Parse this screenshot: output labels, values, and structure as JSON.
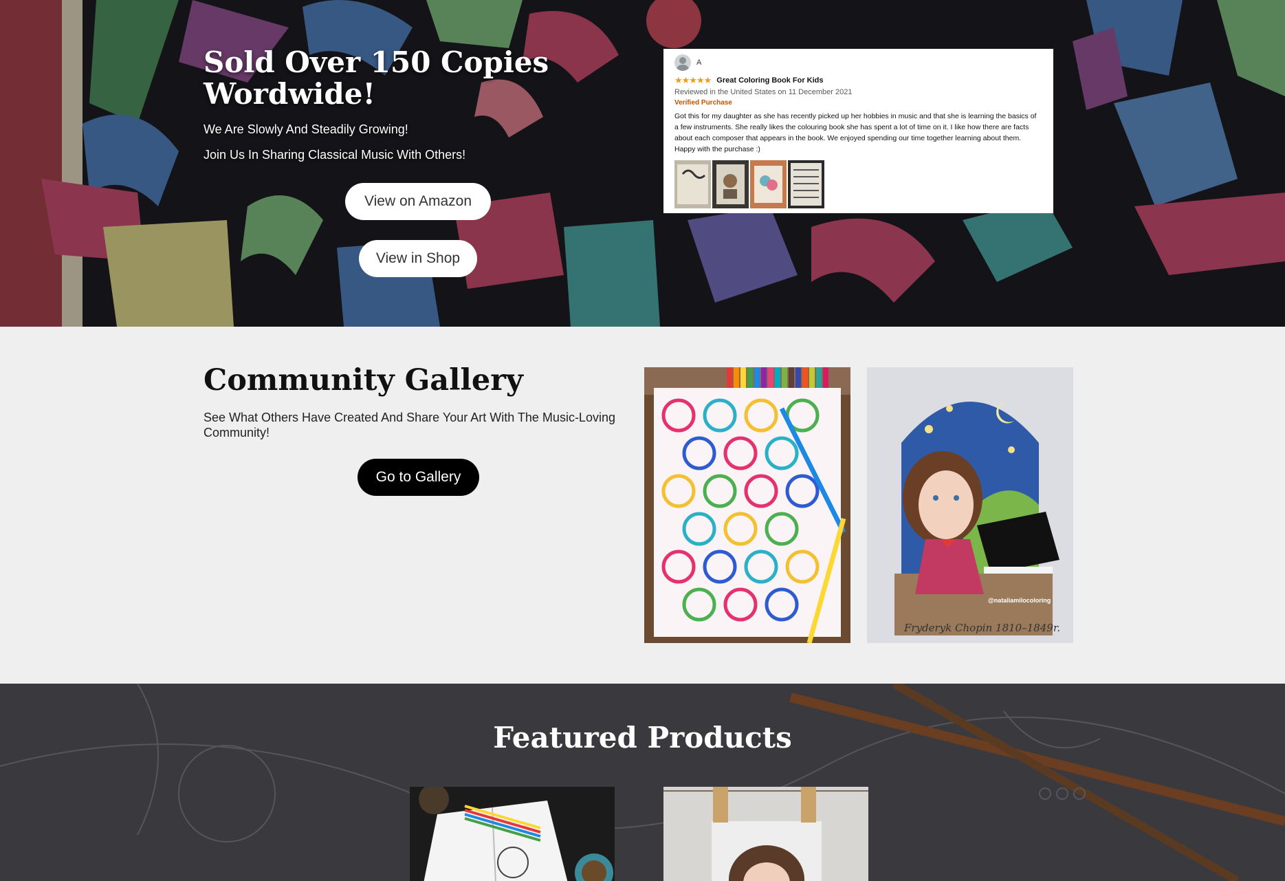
{
  "hero": {
    "title": "Sold Over 150 Copies Wordwide!",
    "line1": "We Are Slowly And Steadily Growing!",
    "line2": "Join Us In Sharing Classical Music With Others!",
    "amazon_button": "View on Amazon",
    "shop_button": "View in Shop"
  },
  "review": {
    "reviewer": "A",
    "stars": "★★★★★",
    "rating": 5,
    "title": "Great Coloring Book For Kids",
    "meta": "Reviewed in the United States on 11 December 2021",
    "verified": "Verified Purchase",
    "body": "Got this for my daughter as she has recently picked up her hobbies in music and that she is learning the basics of a few instruments. She really likes the colouring book she has spent a lot of time on it. I like how there are facts about each composer that appears in the book. We enjoyed spending our time together learning about them. Happy with the purchase :)"
  },
  "gallery": {
    "title": "Community Gallery",
    "subtitle": "See What Others Have Created And Share Your Art With The Music-Loving Community!",
    "button": "Go to Gallery",
    "image2_watermark": "@nataliamilocoloring",
    "image2_caption": "Fryderyk Chopin  1810–1849r."
  },
  "featured": {
    "title": "Featured Products"
  },
  "colors": {
    "button_dark": "#000000",
    "button_light": "#ffffff",
    "star": "#f29a1a",
    "verified": "#c45500",
    "gallery_bg": "#efefef",
    "featured_bg": "#3b3b3e"
  }
}
